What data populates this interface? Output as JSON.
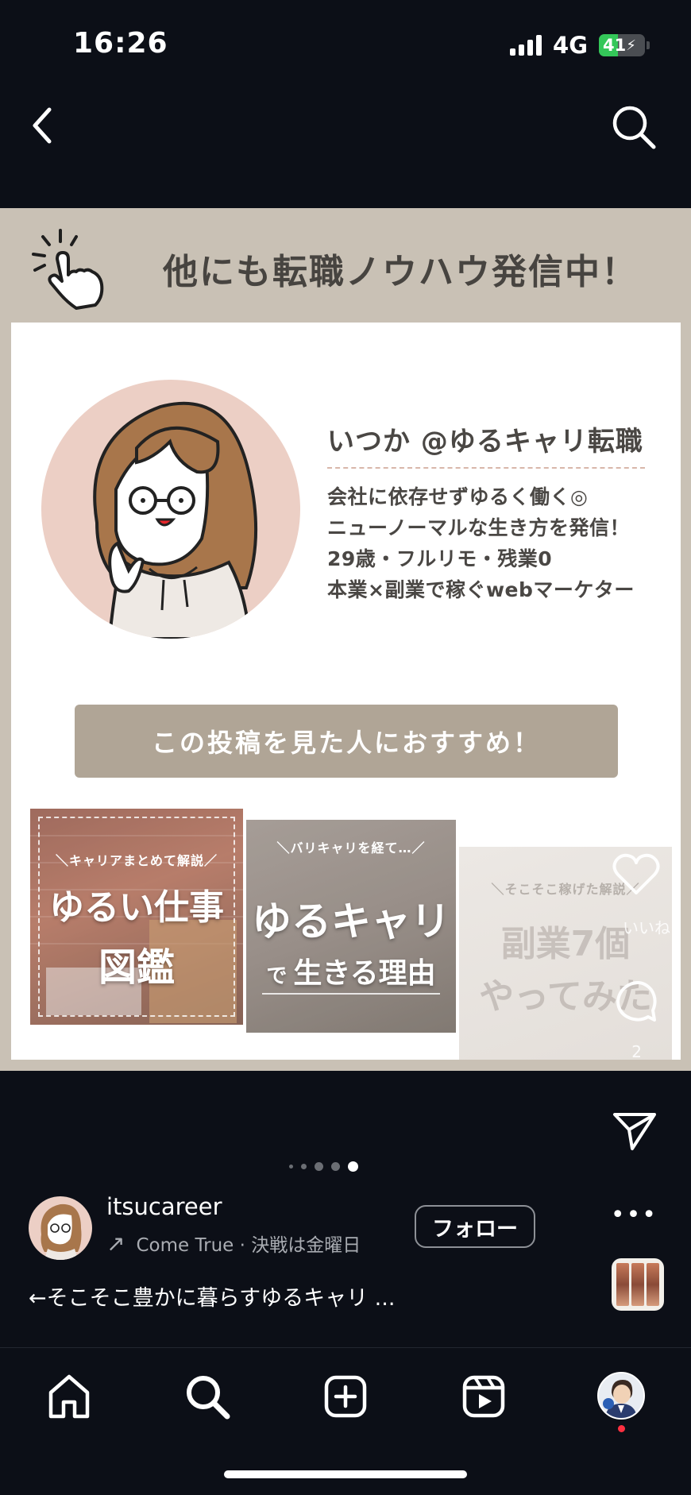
{
  "status_bar": {
    "time": "16:26",
    "network": "4G",
    "battery": "41",
    "battery_level": 0.41
  },
  "post": {
    "headline": "他にも転職ノウハウ発信中！",
    "profile": {
      "name": "いつか @ゆるキャリ転職",
      "bio": [
        "会社に依存せずゆるく働く◎",
        "ニューノーマルな生き方を発信！",
        "29歳・フルリモ・残業0",
        "本業×副業で稼ぐwebマーケター"
      ]
    },
    "recommend": "この投稿を見た人におすすめ！",
    "thumbnails": [
      {
        "subtitle": "＼キャリアまとめて解説／",
        "title_line1": "ゆるい仕事",
        "title_line2": "図鑑"
      },
      {
        "subtitle": "＼バリキャリを経て…／",
        "title_line1": "ゆるキャリ",
        "title_line2_small": "で",
        "title_line2": "生きる理由"
      },
      {
        "subtitle": "＼そこそこ稼げた解説／",
        "title_line1": "副業7個",
        "title_line2": "やってみた"
      }
    ]
  },
  "side_actions": {
    "like_label": "いいね",
    "comment_count": "2"
  },
  "carousel": {
    "count": 5,
    "active_index": 4
  },
  "author": {
    "username": "itsucareer",
    "music": "Come True · 決戦は金曜日",
    "follow_label": "フォロー",
    "more_label": "•••",
    "caption": "←そこそこ豊かに暮らすゆるキャリ ..."
  },
  "colors": {
    "background": "#0c0f17",
    "post_frame": "#c9c1b5",
    "banner": "#b0a596",
    "avatar_bg": "#eccfc5",
    "battery_green": "#34c759",
    "notification": "#ff3040"
  },
  "tabbar": {
    "icons": [
      "home-icon",
      "search-icon",
      "create-icon",
      "reels-icon",
      "profile-avatar"
    ]
  }
}
